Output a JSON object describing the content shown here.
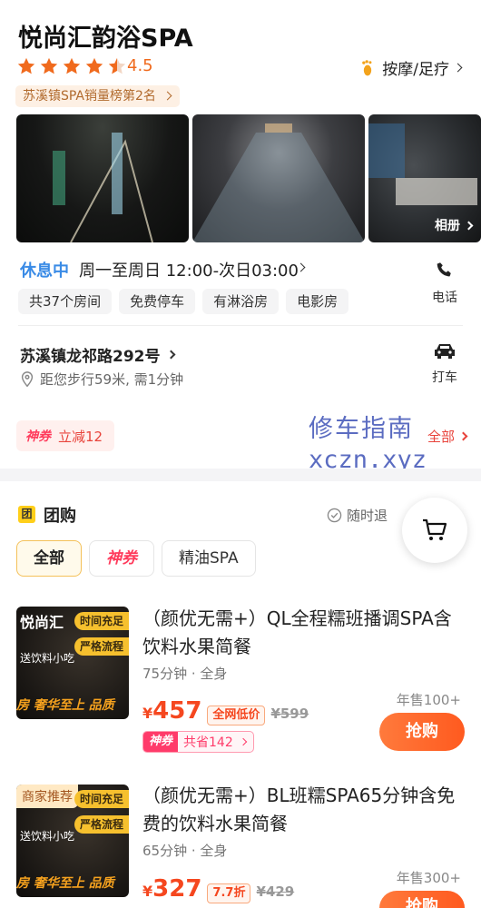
{
  "store": {
    "name": "悦尚汇韵浴SPA",
    "rating": "4.5",
    "category": "按摩/足疗",
    "rank": "苏溪镇SPA销量榜第2名"
  },
  "gallery": {
    "album_label": "相册"
  },
  "hours": {
    "status": "休息中",
    "schedule": "周一至周日 12:00-次日03:00"
  },
  "tags": [
    "共37个房间",
    "免费停车",
    "有淋浴房",
    "电影房"
  ],
  "actions": {
    "phone": "电话",
    "taxi": "打车"
  },
  "address": {
    "street": "苏溪镇龙祁路292号",
    "distance": "距您步行59米, 需1分钟"
  },
  "coupon": {
    "badge": "神券",
    "text": "立减12",
    "more": "全部"
  },
  "watermark": {
    "line1": "修车指南",
    "line2": "xczn.xyz"
  },
  "group_buy": {
    "icon_text": "团",
    "title": "团购",
    "refund": "随时退",
    "filters": [
      "全部",
      "神券",
      "精油SPA"
    ]
  },
  "deals": [
    {
      "thumb_brand": "悦尚汇",
      "thumb_labels": [
        "时间充足",
        "严格流程"
      ],
      "thumb_sub": "送饮料小吃",
      "thumb_bottom": "房 奢华至上 品质",
      "title": "（颜优无需+）QL全程糯班播调SPA含饮料水果简餐",
      "meta": "75分钟 · 全身",
      "currency": "¥",
      "price": "457",
      "badge": "全网低价",
      "original": "¥599",
      "sold": "年售100+",
      "buy": "抢购",
      "savings_badge": "神券",
      "savings_text": "共省142"
    },
    {
      "thumb_merchant": "商家推荐",
      "thumb_labels": [
        "时间充足",
        "严格流程"
      ],
      "thumb_sub": "送饮料小吃",
      "thumb_bottom": "房 奢华至上 品质",
      "title": "（颜优无需+）BL班糯SPA65分钟含免费的饮料水果简餐",
      "meta": "65分钟 · 全身",
      "currency": "¥",
      "price": "327",
      "badge": "7.7折",
      "original": "¥429",
      "sold": "年售300+",
      "buy": "抢购"
    }
  ],
  "colors": {
    "accent": "#f5471f",
    "star": "#f06a1d",
    "status_blue": "#3a8be6",
    "coupon_red": "#e8433b"
  }
}
